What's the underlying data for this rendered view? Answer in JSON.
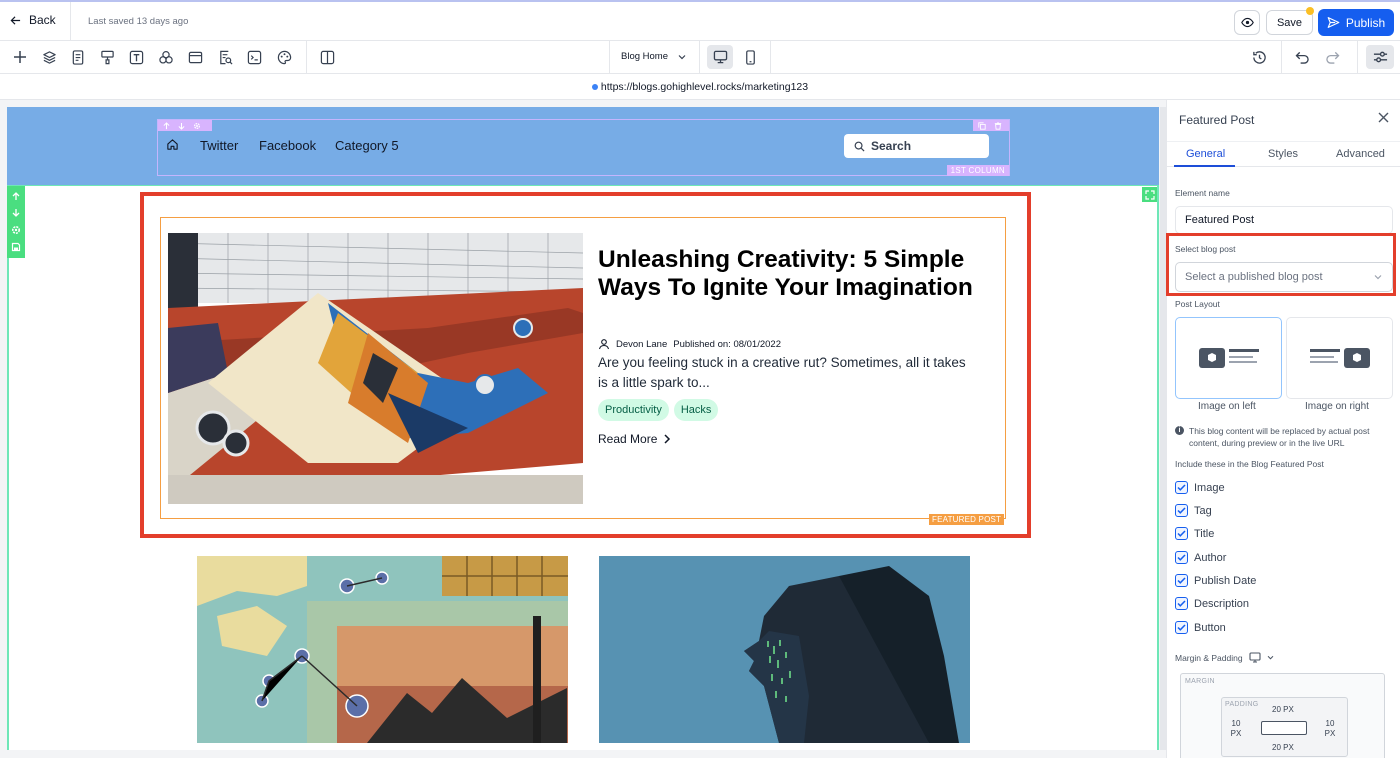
{
  "topbar": {
    "back_label": "Back",
    "saved_status": "Last saved 13 days ago",
    "save_label": "Save",
    "publish_label": "Publish"
  },
  "toolbar": {
    "tools": [
      "add-icon",
      "layers-icon",
      "pages-icon",
      "paint-icon",
      "text-icon",
      "elements-icon",
      "section-icon",
      "search-page-icon",
      "code-icon",
      "theme-icon",
      "columns-icon"
    ],
    "page_select": "Blog Home",
    "devices": [
      "desktop",
      "mobile"
    ]
  },
  "url": "https://blogs.gohighlevel.rocks/marketing123",
  "canvas": {
    "nav": {
      "items": [
        "Twitter",
        "Facebook",
        "Category 5"
      ],
      "search_label": "Search",
      "column_tag": "1ST COLUMN"
    },
    "featured": {
      "title": "Unleashing Creativity: 5 Simple Ways To Ignite Your Imagination",
      "author": "Devon Lane",
      "published": "Published on: 08/01/2022",
      "description": "Are you feeling stuck in a creative rut? Sometimes, all it takes is a little spark to...",
      "tags": [
        "Productivity",
        "Hacks"
      ],
      "read_more": "Read More",
      "element_tag": "FEATURED POST"
    }
  },
  "panel": {
    "title": "Featured Post",
    "tabs": [
      "General",
      "Styles",
      "Advanced"
    ],
    "active_tab": "General",
    "element_name_label": "Element name",
    "element_name_value": "Featured Post",
    "select_post_label": "Select blog post",
    "select_post_placeholder": "Select a published blog post",
    "post_layout_label": "Post Layout",
    "layouts": [
      "Image on left",
      "Image on right"
    ],
    "selected_layout": "Image on left",
    "info_text": "This blog content will be replaced by actual post content, during preview or in the live URL",
    "include_label": "Include these in the Blog Featured Post",
    "include_items": [
      {
        "label": "Image",
        "checked": true
      },
      {
        "label": "Tag",
        "checked": true
      },
      {
        "label": "Title",
        "checked": true
      },
      {
        "label": "Author",
        "checked": true
      },
      {
        "label": "Publish Date",
        "checked": true
      },
      {
        "label": "Description",
        "checked": true
      },
      {
        "label": "Button",
        "checked": true
      }
    ],
    "margin_padding_label": "Margin & Padding",
    "spacing": {
      "margin_label": "MARGIN",
      "padding_label": "PADDING",
      "padding_top": "20 PX",
      "padding_bottom": "20 PX",
      "padding_left": "10 PX",
      "padding_right": "10 PX"
    }
  },
  "colors": {
    "accent": "#155eef",
    "nav_bg": "#77ace6",
    "highlight_red": "#e33e2b",
    "featured_outline": "#f59e42",
    "tag_bg": "#d1fae5"
  }
}
